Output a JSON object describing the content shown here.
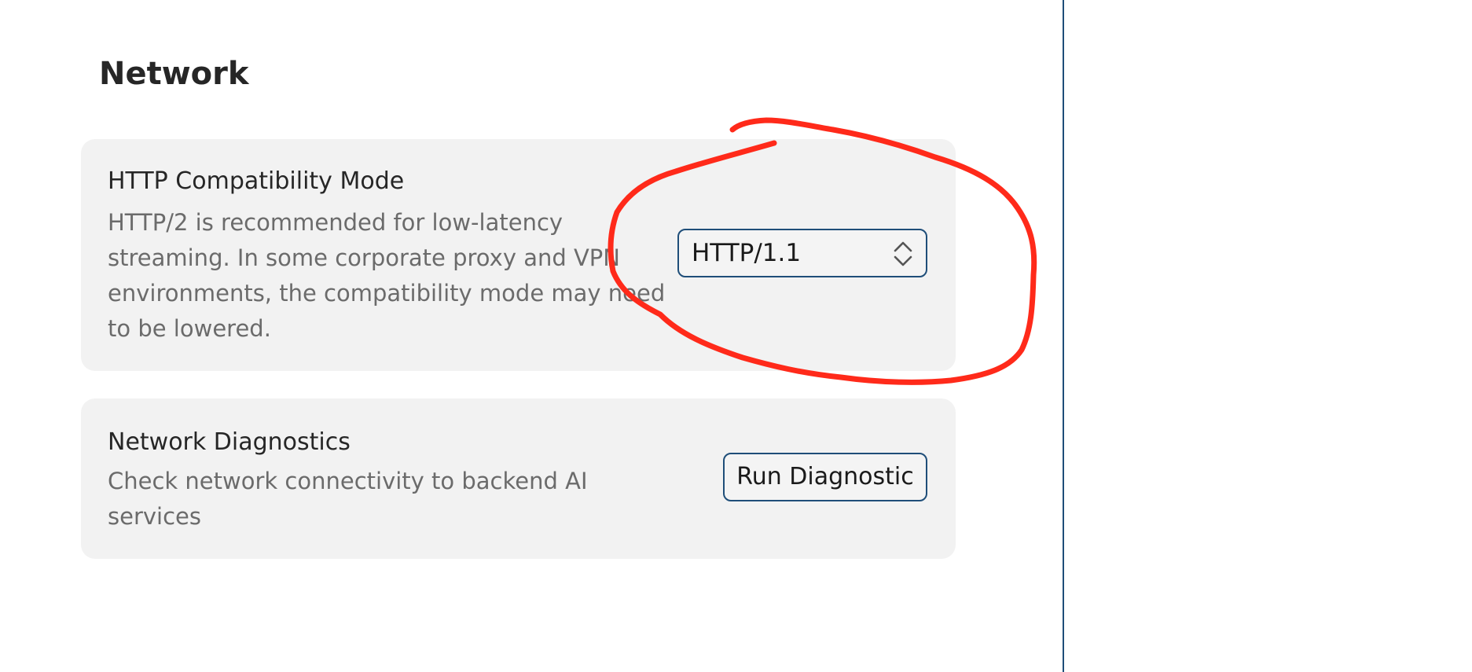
{
  "page": {
    "title": "Network"
  },
  "http_mode": {
    "title": "HTTP Compatibility Mode",
    "description": "HTTP/2 is recommended for low-latency streaming. In some corporate proxy and VPN environments, the compatibility mode may need to be lowered.",
    "selected_value": "HTTP/1.1",
    "chevron_icon": "chevron-up-down-icon"
  },
  "diagnostics": {
    "title": "Network Diagnostics",
    "description": "Check network connectivity to backend AI services",
    "button_label": "Run Diagnostic"
  },
  "colors": {
    "accent_border": "#1f4e79",
    "card_background": "#f2f2f2",
    "annotation_red": "#ff2a1a"
  }
}
